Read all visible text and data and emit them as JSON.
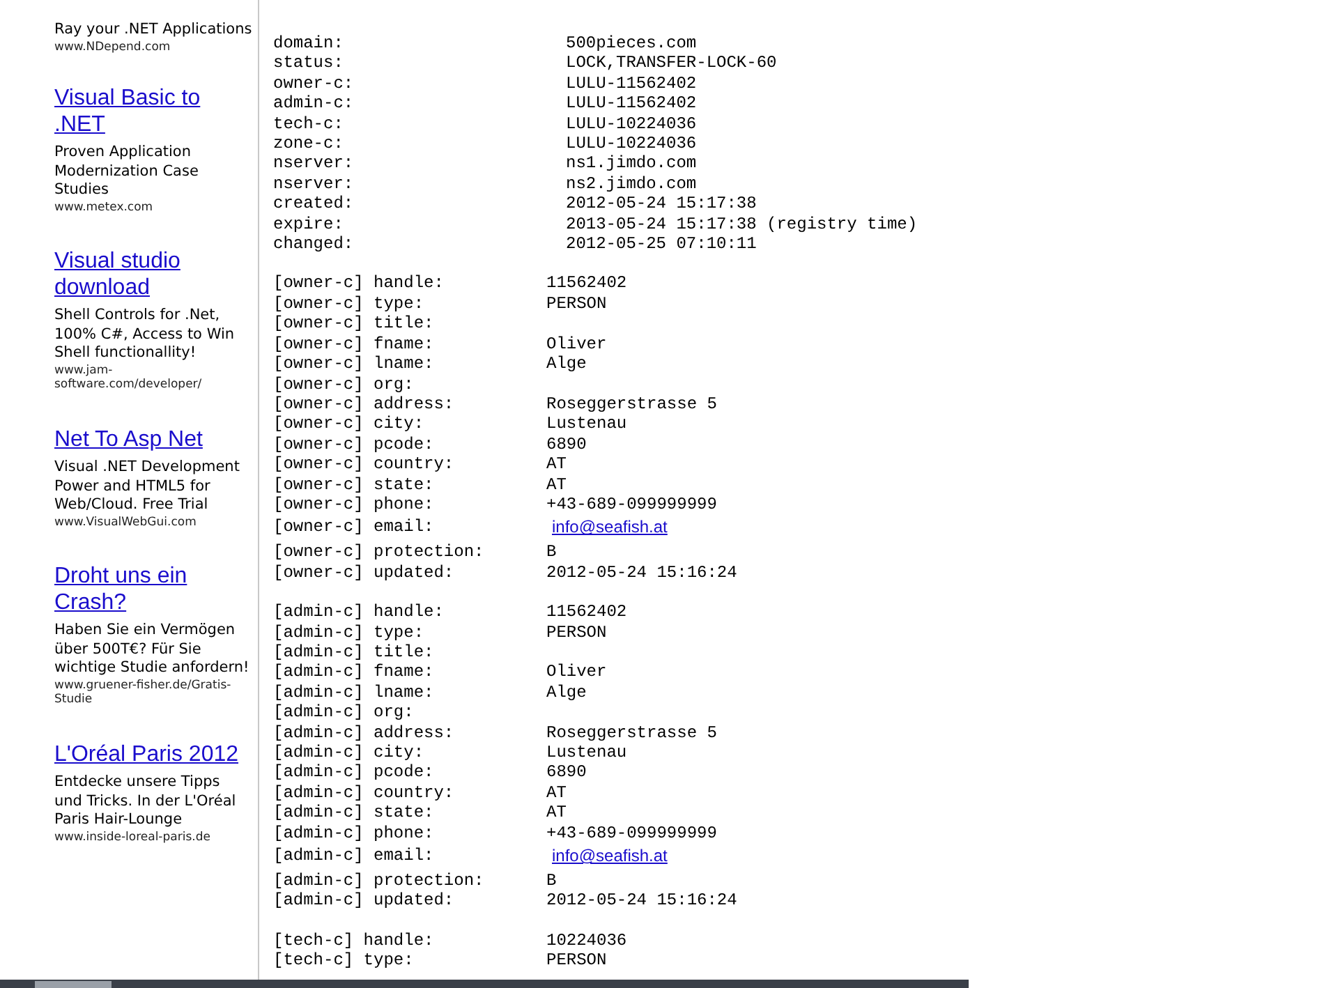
{
  "sidebar": {
    "ads": [
      {
        "body": "Ray your .NET Applications",
        "url": "www.NDepend.com"
      },
      {
        "title": "Visual Basic to .NET",
        "body": "Proven Application Modernization Case Studies",
        "url": "www.metex.com"
      },
      {
        "title": "Visual studio download",
        "body": "Shell Controls for .Net, 100% C#, Access to Win Shell functionallity!",
        "url": "www.jam-software.com/developer/"
      },
      {
        "title": "Net To Asp Net",
        "body": "Visual .NET Development Power and HTML5 for Web/Cloud. Free Trial",
        "url": "www.VisualWebGui.com"
      },
      {
        "title": "Droht uns ein Crash?",
        "body": "Haben Sie ein Vermögen über 500T€? Für Sie wichtige Studie anfordern!",
        "url": "www.gruener-fisher.de/Gratis-Studie"
      },
      {
        "title": "L'Oréal Paris 2012",
        "body": "Entdecke unsere Tipps und Tricks. In der L'Oréal Paris Hair-Lounge",
        "url": "www.inside-loreal-paris.de"
      }
    ]
  },
  "whois": {
    "sections": [
      {
        "kind": "domain",
        "rows": [
          {
            "label": "domain:",
            "value": "500pieces.com",
            "kind": "text"
          },
          {
            "label": "status:",
            "value": "LOCK,TRANSFER-LOCK-60",
            "kind": "text"
          },
          {
            "label": "owner-c:",
            "value": "LULU-11562402",
            "kind": "text"
          },
          {
            "label": "admin-c:",
            "value": "LULU-11562402",
            "kind": "text"
          },
          {
            "label": "tech-c:",
            "value": "LULU-10224036",
            "kind": "text"
          },
          {
            "label": "zone-c:",
            "value": "LULU-10224036",
            "kind": "text"
          },
          {
            "label": "nserver:",
            "value": "ns1.jimdo.com",
            "kind": "text"
          },
          {
            "label": "nserver:",
            "value": "ns2.jimdo.com",
            "kind": "text"
          },
          {
            "label": "created:",
            "value": "2012-05-24 15:17:38",
            "kind": "text"
          },
          {
            "label": "expire:",
            "value": "2013-05-24 15:17:38 (registry time)",
            "kind": "text"
          },
          {
            "label": "changed:",
            "value": "2012-05-25 07:10:11",
            "kind": "text"
          }
        ]
      },
      {
        "kind": "contact",
        "rows": [
          {
            "label": "[owner-c] handle:",
            "value": "11562402",
            "kind": "text"
          },
          {
            "label": "[owner-c] type:",
            "value": "PERSON",
            "kind": "text"
          },
          {
            "label": "[owner-c] title:",
            "kind": "text"
          },
          {
            "label": "[owner-c] fname:",
            "value": "Oliver",
            "kind": "text"
          },
          {
            "label": "[owner-c] lname:",
            "value": "Alge",
            "kind": "text"
          },
          {
            "label": "[owner-c] org:",
            "kind": "text"
          },
          {
            "label": "[owner-c] address:",
            "value": "Roseggerstrasse 5",
            "kind": "text"
          },
          {
            "label": "[owner-c] city:",
            "value": "Lustenau",
            "kind": "text"
          },
          {
            "label": "[owner-c] pcode:",
            "value": "6890",
            "kind": "text"
          },
          {
            "label": "[owner-c] country:",
            "value": "AT",
            "kind": "text"
          },
          {
            "label": "[owner-c] state:",
            "value": "AT",
            "kind": "text"
          },
          {
            "label": "[owner-c] phone:",
            "value": "+43-689-099999999",
            "kind": "text"
          },
          {
            "label": "[owner-c] email:",
            "value": "info@seafish.at",
            "kind": "link"
          },
          {
            "label": "[owner-c] protection:",
            "value": "B",
            "kind": "text"
          },
          {
            "label": "[owner-c] updated:",
            "value": "2012-05-24 15:16:24",
            "kind": "text"
          }
        ]
      },
      {
        "kind": "contact",
        "rows": [
          {
            "label": "[admin-c] handle:",
            "value": "11562402",
            "kind": "text"
          },
          {
            "label": "[admin-c] type:",
            "value": "PERSON",
            "kind": "text"
          },
          {
            "label": "[admin-c] title:",
            "kind": "text"
          },
          {
            "label": "[admin-c] fname:",
            "value": "Oliver",
            "kind": "text"
          },
          {
            "label": "[admin-c] lname:",
            "value": "Alge",
            "kind": "text"
          },
          {
            "label": "[admin-c] org:",
            "kind": "text"
          },
          {
            "label": "[admin-c] address:",
            "value": "Roseggerstrasse 5",
            "kind": "text"
          },
          {
            "label": "[admin-c] city:",
            "value": "Lustenau",
            "kind": "text"
          },
          {
            "label": "[admin-c] pcode:",
            "value": "6890",
            "kind": "text"
          },
          {
            "label": "[admin-c] country:",
            "value": "AT",
            "kind": "text"
          },
          {
            "label": "[admin-c] state:",
            "value": "AT",
            "kind": "text"
          },
          {
            "label": "[admin-c] phone:",
            "value": "+43-689-099999999",
            "kind": "text"
          },
          {
            "label": "[admin-c] email:",
            "value": "info@seafish.at",
            "kind": "link"
          },
          {
            "label": "[admin-c] protection:",
            "value": "B",
            "kind": "text"
          },
          {
            "label": "[admin-c] updated:",
            "value": "2012-05-24 15:16:24",
            "kind": "text"
          }
        ]
      },
      {
        "kind": "contact",
        "rows": [
          {
            "label": "[tech-c] handle:",
            "value": "10224036",
            "kind": "text"
          },
          {
            "label": "[tech-c] type:",
            "value": "PERSON",
            "kind": "text"
          }
        ]
      }
    ]
  }
}
